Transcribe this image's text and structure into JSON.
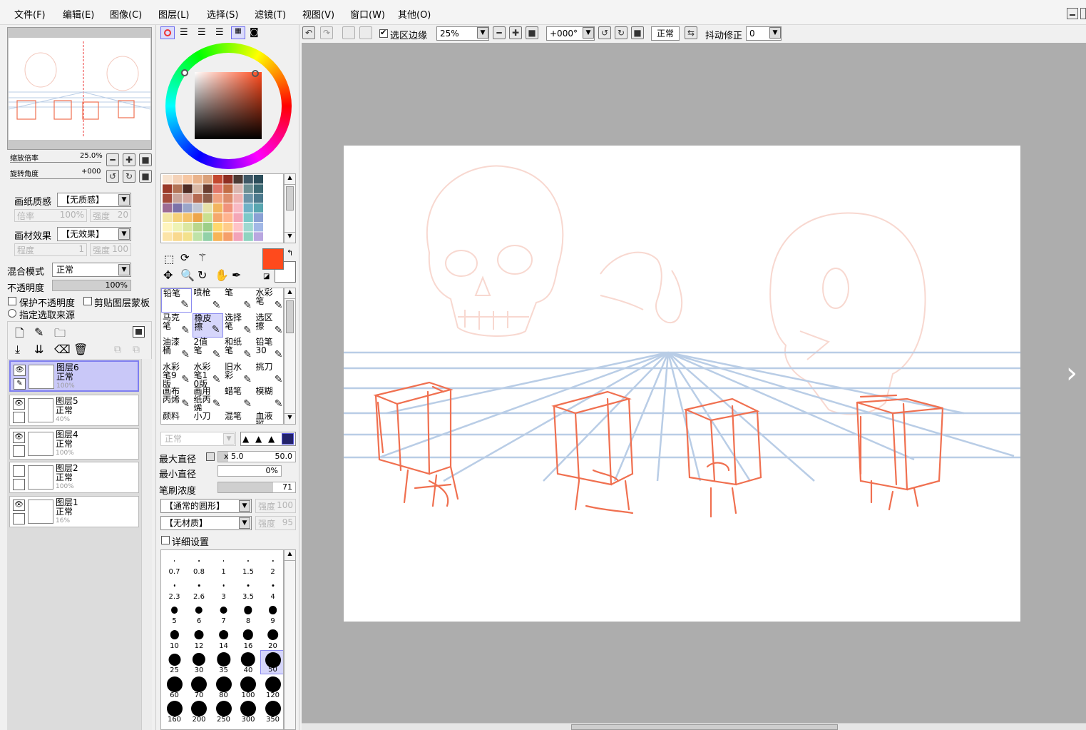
{
  "menu": [
    "文件(F)",
    "编辑(E)",
    "图像(C)",
    "图层(L)",
    "选择(S)",
    "滤镜(T)",
    "视图(V)",
    "窗口(W)",
    "其他(O)"
  ],
  "toolbar": {
    "selection_edge_label": "选区边缘",
    "selection_edge_checked": true,
    "zoom": "25%",
    "rotation": "+000°",
    "blend": "正常",
    "stabilizer_label": "抖动修正",
    "stabilizer_value": "0"
  },
  "navigator": {
    "zoom_label": "缩放倍率",
    "zoom_value": "25.0%",
    "rotate_label": "旋转角度",
    "rotate_value": "+000"
  },
  "layer_props": {
    "paper_texture_label": "画纸质感",
    "paper_texture_value": "【无质感】",
    "paper_scale_label": "倍率",
    "paper_scale_value": "100%",
    "paper_strength_label": "强度",
    "paper_strength_value": "20",
    "material_label": "画材效果",
    "material_value": "【无效果】",
    "material_degree_label": "程度",
    "material_degree_value": "1",
    "material_strength_label": "强度",
    "material_strength_value": "100",
    "blend_label": "混合模式",
    "blend_value": "正常",
    "opacity_label": "不透明度",
    "opacity_value": "100%",
    "protect_opacity": "保护不透明度",
    "clip_mask": "剪贴图层蒙板",
    "selection_source": "指定选取来源"
  },
  "layers": [
    {
      "name": "图层6",
      "mode": "正常",
      "opacity": "100%",
      "visible": true,
      "selected": true
    },
    {
      "name": "图层5",
      "mode": "正常",
      "opacity": "40%",
      "visible": true,
      "selected": false
    },
    {
      "name": "图层4",
      "mode": "正常",
      "opacity": "100%",
      "visible": true,
      "selected": false
    },
    {
      "name": "图层2",
      "mode": "正常",
      "opacity": "100%",
      "visible": false,
      "selected": false
    },
    {
      "name": "图层1",
      "mode": "正常",
      "opacity": "16%",
      "visible": true,
      "selected": false
    }
  ],
  "colors": {
    "primary": "#ff4a1c",
    "secondary": "#ffffff",
    "guide_blue": "#b9cde6",
    "sketch_red": "#f07050",
    "faint_red": "#f8d8d0"
  },
  "tools": [
    {
      "label": "铅笔",
      "icon": "pencil-icon"
    },
    {
      "label": "喷枪",
      "icon": "airbrush-icon"
    },
    {
      "label": "笔",
      "icon": "pen-icon"
    },
    {
      "label": "水彩笔",
      "icon": "watercolor-icon"
    },
    {
      "label": "马克笔",
      "icon": "marker-icon"
    },
    {
      "label": "橡皮擦",
      "icon": "eraser-icon"
    },
    {
      "label": "选择笔",
      "icon": "select-pen-icon"
    },
    {
      "label": "选区擦",
      "icon": "select-eraser-icon"
    },
    {
      "label": "油漆桶",
      "icon": "bucket-icon"
    },
    {
      "label": "2值笔",
      "icon": "binary-pen-icon"
    },
    {
      "label": "和纸笔",
      "icon": "washi-pen-icon"
    },
    {
      "label": "铅笔30",
      "icon": "pencil30-icon"
    },
    {
      "label": "水彩笔9版",
      "icon": "watercolor9-icon"
    },
    {
      "label": "水彩笔10版",
      "icon": "watercolor10-icon"
    },
    {
      "label": "旧水彩",
      "icon": "old-watercolor-icon"
    },
    {
      "label": "挑刀",
      "icon": "knife-icon"
    },
    {
      "label": "画布丙烯",
      "icon": "canvas-acrylic-icon"
    },
    {
      "label": "画用纸丙烯",
      "icon": "paper-acrylic-icon"
    },
    {
      "label": "蜡笔",
      "icon": "crayon-icon"
    },
    {
      "label": "模糊",
      "icon": "blur-icon"
    },
    {
      "label": "颜料",
      "icon": "paint-icon"
    },
    {
      "label": "小刀",
      "icon": "small-knife-icon"
    },
    {
      "label": "混笔",
      "icon": "mix-pen-icon"
    },
    {
      "label": "血液斑",
      "icon": "blood-icon"
    }
  ],
  "brush": {
    "mode": "正常",
    "max_diam_label": "最大直径",
    "max_diam_mult": "x 5.0",
    "max_diam_value": "50.0",
    "min_diam_label": "最小直径",
    "min_diam_value": "0%",
    "density_label": "笔刷浓度",
    "density_value": "71",
    "shape": "【通常的圆形】",
    "shape_strength_label": "强度",
    "shape_strength_value": "100",
    "texture": "【无材质】",
    "texture_strength_label": "强度",
    "texture_strength_value": "95",
    "detail_label": "详细设置",
    "density_fraction": 0.71
  },
  "brush_sizes": [
    "0.7",
    "0.8",
    "1",
    "1.5",
    "2",
    "2.3",
    "2.6",
    "3",
    "3.5",
    "4",
    "5",
    "6",
    "7",
    "8",
    "9",
    "10",
    "12",
    "14",
    "16",
    "20",
    "25",
    "30",
    "35",
    "40",
    "50",
    "60",
    "70",
    "80",
    "100",
    "120",
    "160",
    "200",
    "250",
    "300",
    "350"
  ],
  "selected_brush_size": "50"
}
